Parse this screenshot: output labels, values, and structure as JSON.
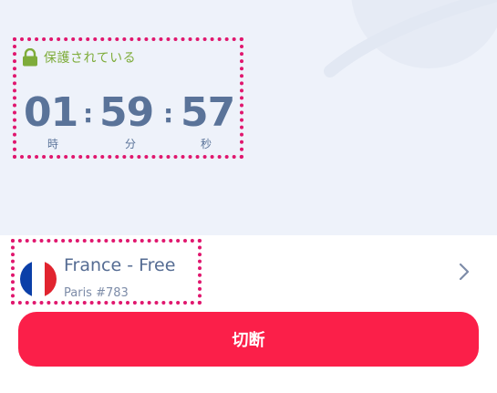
{
  "status": {
    "text": "保護されている",
    "icon": "lock-icon"
  },
  "timer": {
    "hours": "01",
    "minutes": "59",
    "seconds": "57",
    "separator": ":",
    "units": {
      "hours": "時",
      "minutes": "分",
      "seconds": "秒"
    }
  },
  "server": {
    "name": "France - Free",
    "location": "Paris #783",
    "flag": "france-flag-icon",
    "flag_colors": [
      "#0b3fa8",
      "#ffffff",
      "#e1242f"
    ]
  },
  "disconnect_button": {
    "label": "切断",
    "color": "#fb1f49"
  }
}
